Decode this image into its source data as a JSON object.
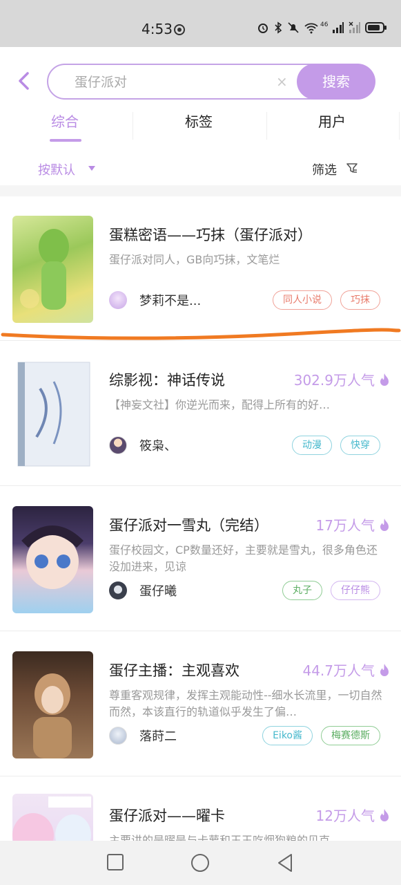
{
  "status_bar": {
    "time": "4:53",
    "icons": [
      "alarm-icon",
      "bluetooth-icon",
      "mute-icon",
      "wifi-icon",
      "signal-icon",
      "signal-icon",
      "battery-icon"
    ],
    "network_label": "46"
  },
  "search": {
    "value": "蛋仔派对",
    "clear_glyph": "×",
    "button_label": "搜索"
  },
  "tabs": [
    {
      "label": "综合",
      "active": true
    },
    {
      "label": "标签",
      "active": false
    },
    {
      "label": "用户",
      "active": false
    }
  ],
  "sort": {
    "label": "按默认",
    "filter_label": "筛选"
  },
  "books": [
    {
      "title": "蛋糕密语——巧抹（蛋仔派对）",
      "heat": "",
      "desc": "蛋仔派对同人，GB向巧抹，文笔烂",
      "author": "梦莉不是...",
      "tags": [
        {
          "label": "同人小说",
          "color": "red"
        },
        {
          "label": "巧抹",
          "color": "red"
        }
      ]
    },
    {
      "title": "综影视：神话传说",
      "heat": "302.9万人气",
      "desc": "【神妄文社】你逆光而来，配得上所有的好…",
      "author": "筱枭、",
      "tags": [
        {
          "label": "动漫",
          "color": "blue"
        },
        {
          "label": "快穿",
          "color": "blue"
        }
      ]
    },
    {
      "title": "蛋仔派对一雪丸（完结）",
      "heat": "17万人气",
      "desc": "蛋仔校园文，CP数量还好，主要就是雪丸，很多角色还没加进来，见谅",
      "author": "蛋仔曦",
      "tags": [
        {
          "label": "丸子",
          "color": "green"
        },
        {
          "label": "仔仔熊",
          "color": "purple"
        }
      ]
    },
    {
      "title": "蛋仔主播：主观喜欢",
      "heat": "44.7万人气",
      "desc": "尊重客观规律，发挥主观能动性--细水长流里，一切自然而然，本该直行的轨道似乎发生了偏…",
      "author": "落莳二",
      "tags": [
        {
          "label": "Eiko酱",
          "color": "blue"
        },
        {
          "label": "梅赛德斯",
          "color": "green"
        }
      ]
    },
    {
      "title": "蛋仔派对——曜卡",
      "heat": "12万人气",
      "desc": "主要讲的是曜是与卡萝和王王吃烟狗粮的贝克",
      "author": "",
      "tags": []
    }
  ],
  "colors": {
    "accent": "#c49be8",
    "highlight_stroke": "#f07a22"
  }
}
